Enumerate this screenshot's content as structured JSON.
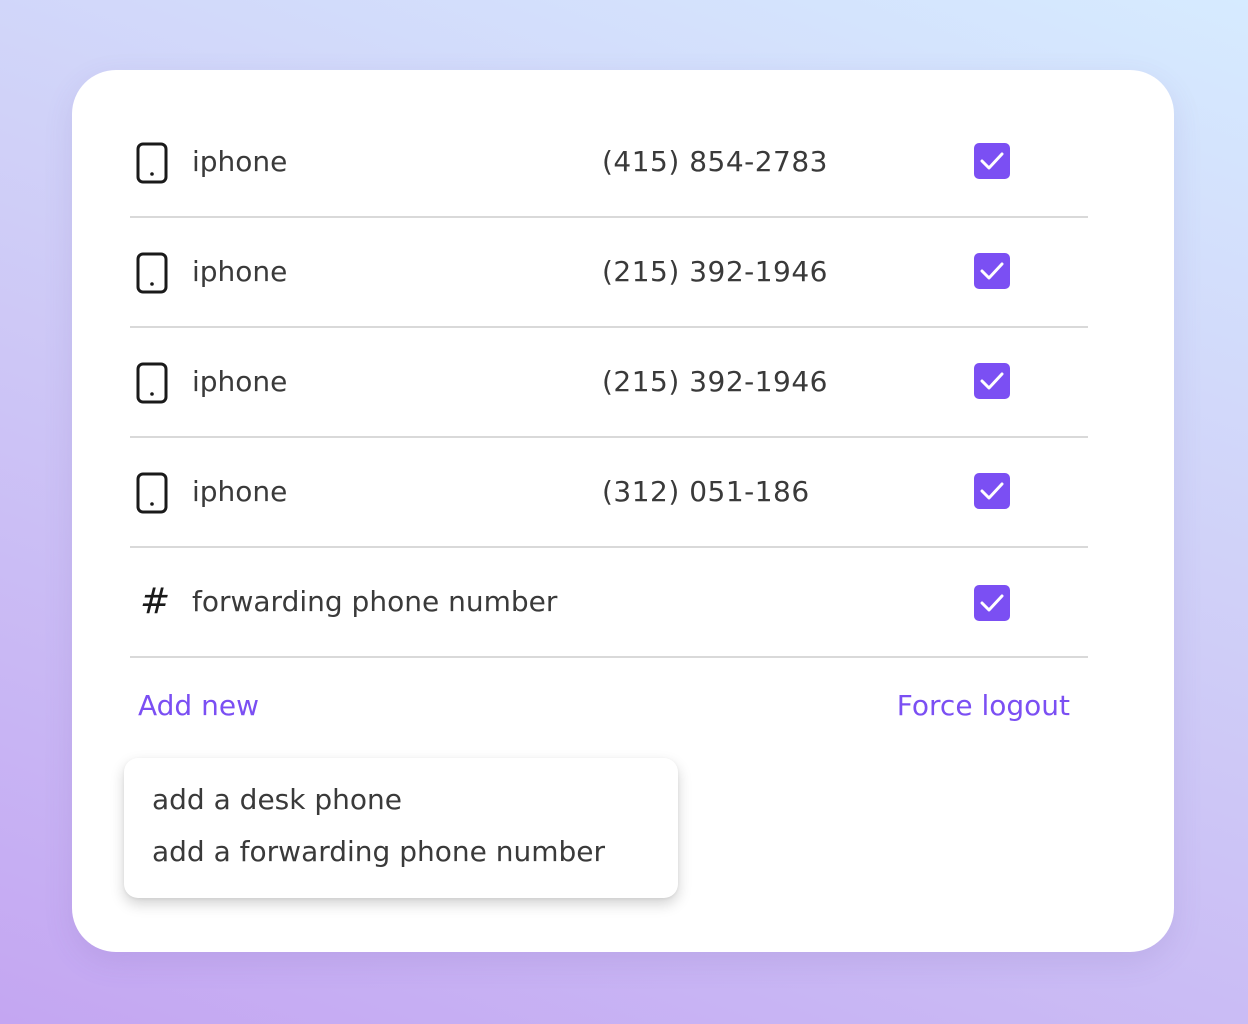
{
  "colors": {
    "accent": "#7b4ff3",
    "text": "#3a3a3a",
    "divider": "#d9d9d9",
    "card": "#ffffff"
  },
  "devices": [
    {
      "icon": "smartphone-icon",
      "label": "iphone",
      "number": "(415) 854-2783",
      "checked": true
    },
    {
      "icon": "smartphone-icon",
      "label": "iphone",
      "number": "(215) 392-1946",
      "checked": true
    },
    {
      "icon": "smartphone-icon",
      "label": "iphone",
      "number": "(215) 392-1946",
      "checked": true
    },
    {
      "icon": "smartphone-icon",
      "label": "iphone",
      "number": "(312) 051-186",
      "checked": true
    },
    {
      "icon": "hash-icon",
      "glyph": "#",
      "label": "forwarding phone number",
      "number": "",
      "checked": true
    }
  ],
  "actions": {
    "add_new": "Add new",
    "force_logout": "Force logout"
  },
  "add_menu": {
    "items": [
      "add a desk phone",
      "add a forwarding phone number"
    ]
  }
}
